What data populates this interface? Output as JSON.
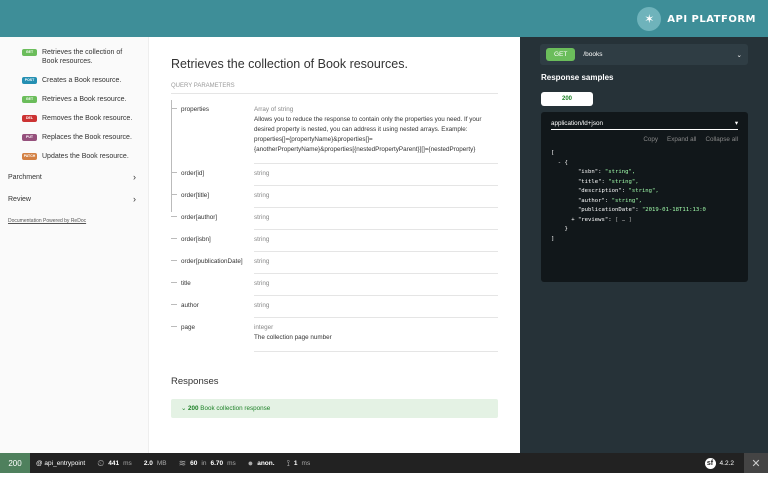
{
  "header": {
    "brand": "API PLATFORM"
  },
  "sidebar": {
    "items": [
      {
        "method": "GET",
        "label": "Retrieves the collection of Book resources.",
        "color": "#6bbd5b"
      },
      {
        "method": "POST",
        "label": "Creates a Book resource.",
        "color": "#248fb2"
      },
      {
        "method": "GET",
        "label": "Retrieves a Book resource.",
        "color": "#6bbd5b"
      },
      {
        "method": "DEL",
        "label": "Removes the Book resource.",
        "color": "#cc3333"
      },
      {
        "method": "PUT",
        "label": "Replaces the Book resource.",
        "color": "#95507c"
      },
      {
        "method": "PATCH",
        "label": "Updates the Book resource.",
        "color": "#d38042"
      }
    ],
    "groups": [
      "Parchment",
      "Review"
    ],
    "powered": "Documentation Powered by ReDoc"
  },
  "main": {
    "title": "Retrieves the collection of Book resources.",
    "query_params_title": "QUERY PARAMETERS",
    "params": [
      {
        "name": "properties",
        "type": "Array of string",
        "desc": "Allows you to reduce the response to contain only the properties you need. If your desired property is nested, you can address it using nested arrays. Example: properties[]={propertyName}&properties[]={anotherPropertyName}&properties[{nestedPropertyParent}][]={nestedProperty}"
      },
      {
        "name": "order[id]",
        "type": "string",
        "desc": ""
      },
      {
        "name": "order[title]",
        "type": "string",
        "desc": ""
      },
      {
        "name": "order[author]",
        "type": "string",
        "desc": ""
      },
      {
        "name": "order[isbn]",
        "type": "string",
        "desc": ""
      },
      {
        "name": "order[publicationDate]",
        "type": "string",
        "desc": ""
      },
      {
        "name": "title",
        "type": "string",
        "desc": ""
      },
      {
        "name": "author",
        "type": "string",
        "desc": ""
      },
      {
        "name": "page",
        "type": "integer",
        "desc": "The collection page number"
      }
    ],
    "responses_title": "Responses",
    "response_code": "200",
    "response_label": "Book collection response"
  },
  "right": {
    "method": "GET",
    "path": "/books",
    "samples_title": "Response samples",
    "tab": "200",
    "content_type": "application/ld+json",
    "actions": [
      "Copy",
      "Expand all",
      "Collapse all"
    ],
    "code_lines": [
      "[",
      "  - {",
      "        \"isbn\": \"string\",",
      "        \"title\": \"string\",",
      "        \"description\": \"string\",",
      "        \"author\": \"string\",",
      "        \"publicationDate\": \"2019-01-18T11:13:0",
      "      + \"reviews\": [ … ]",
      "    }",
      "]"
    ]
  },
  "toolbar": {
    "status": "200",
    "route": "@ api_entrypoint",
    "time": "441",
    "time_unit": "ms",
    "memory": "2.0",
    "memory_unit": "MB",
    "db_queries": "60",
    "db_in": "in",
    "db_time": "6.70",
    "db_unit": "ms",
    "user": "anon.",
    "twig_time": "1",
    "twig_unit": "ms",
    "version": "4.2.2"
  }
}
